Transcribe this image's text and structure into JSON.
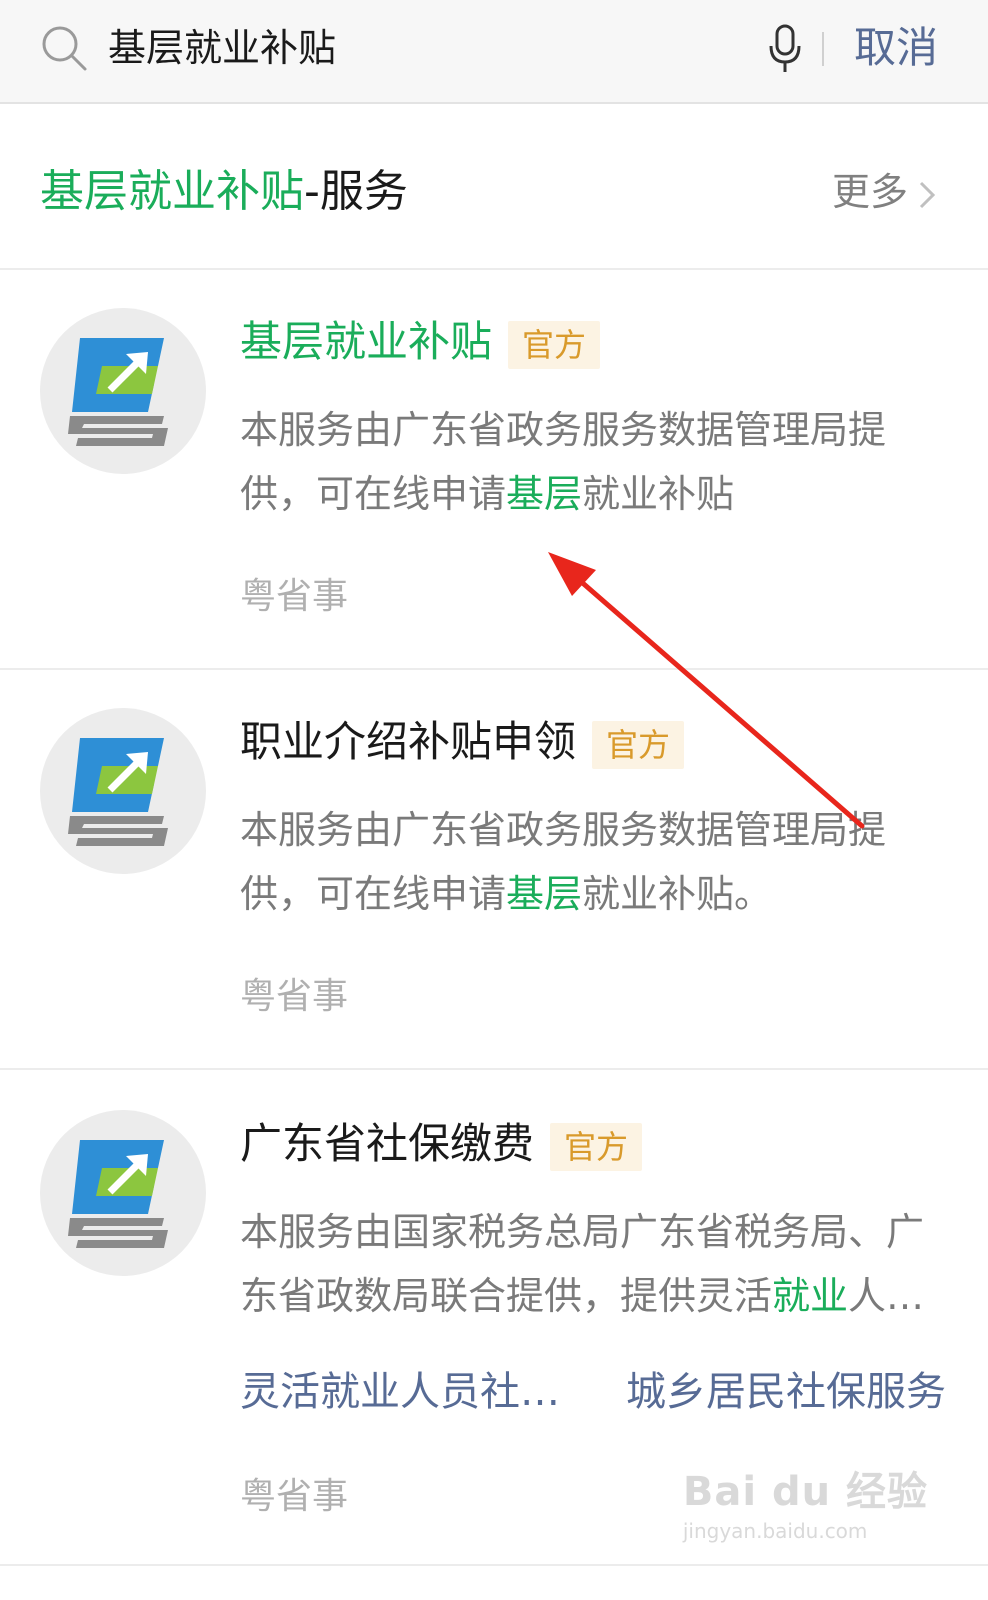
{
  "search": {
    "query": "基层就业补贴",
    "cancel_label": "取消"
  },
  "section": {
    "title_highlight": "基层就业补贴",
    "title_rest": "-服务",
    "more_label": "更多"
  },
  "cards": [
    {
      "title_highlight": "基层",
      "title_highlight2": "就业补贴",
      "badge": "官方",
      "desc_line1": "本服务由广东省政务服务数据管理局提",
      "desc_line2_a": "供，可在线申请",
      "desc_line2_hl": "基层",
      "desc_line2_b": "就业补贴",
      "source": "粤省事"
    },
    {
      "title": "职业介绍补贴申领",
      "badge": "官方",
      "desc_line1": "本服务由广东省政务服务数据管理局提",
      "desc_line2_a": "供，可在线申请",
      "desc_line2_hl": "基层",
      "desc_line2_b": "就业补贴。",
      "source": "粤省事"
    },
    {
      "title": "广东省社保缴费",
      "badge": "官方",
      "desc_line1": "本服务由国家税务总局广东省税务局、广",
      "desc_line2_a": "东省政数局联合提供，提供灵活",
      "desc_line2_hl": "就业",
      "desc_line2_b": "人…",
      "sub_links": [
        "灵活就业人员社…",
        "城乡居民社保服务"
      ],
      "source": "粤省事"
    }
  ],
  "watermark": {
    "main": "Bai du 经验",
    "sub": "jingyan.baidu.com"
  },
  "colors": {
    "highlight": "#1aad5a",
    "link": "#576b95",
    "badge_bg": "#fcf3e3",
    "badge_text": "#d99a2b",
    "arrow": "#e8261c"
  }
}
